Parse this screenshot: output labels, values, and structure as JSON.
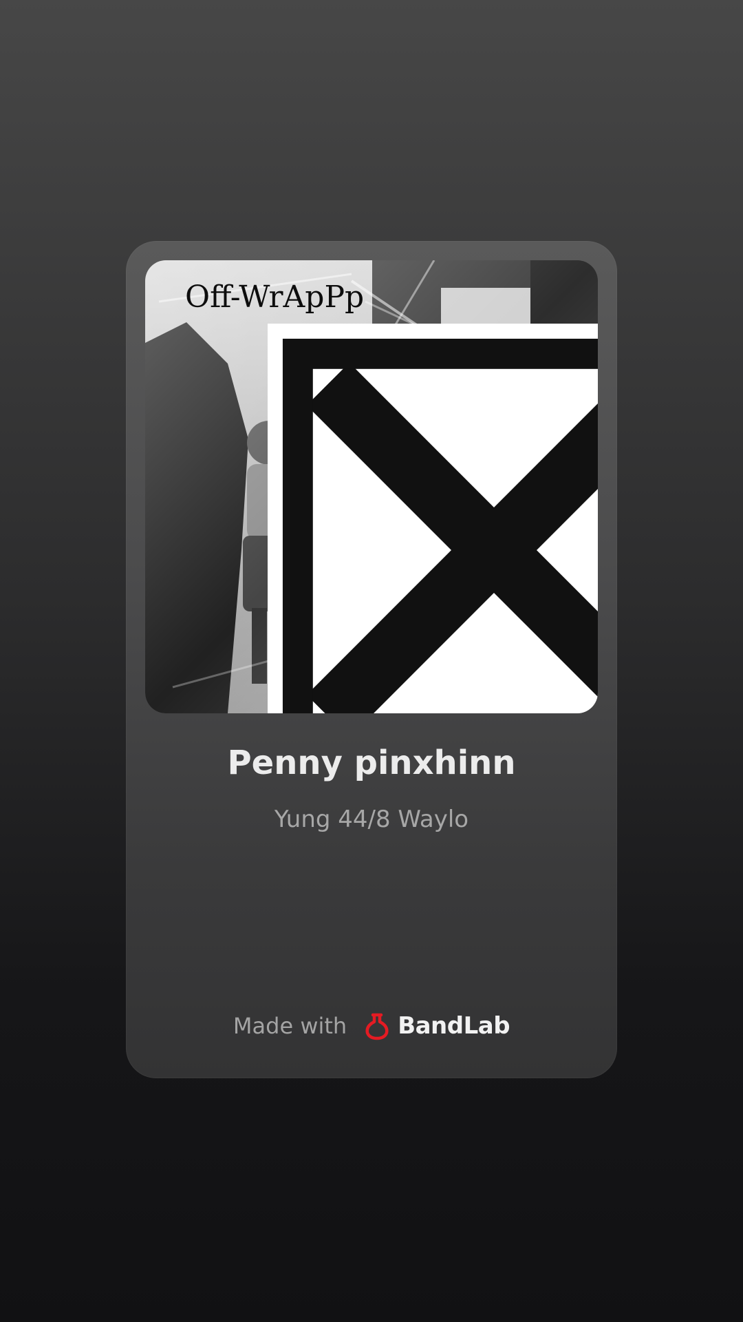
{
  "cover": {
    "overlay_text": "Off-WrApPp",
    "tag_icon": "cross-arrows-icon"
  },
  "track": {
    "title": "Penny pinxhinn",
    "artist": "Yung 44/8 Waylo"
  },
  "footer": {
    "made_with_label": "Made with",
    "brand_icon": "bandlab-flask-icon",
    "brand_name": "BandLab",
    "brand_color": "#e41b23"
  }
}
